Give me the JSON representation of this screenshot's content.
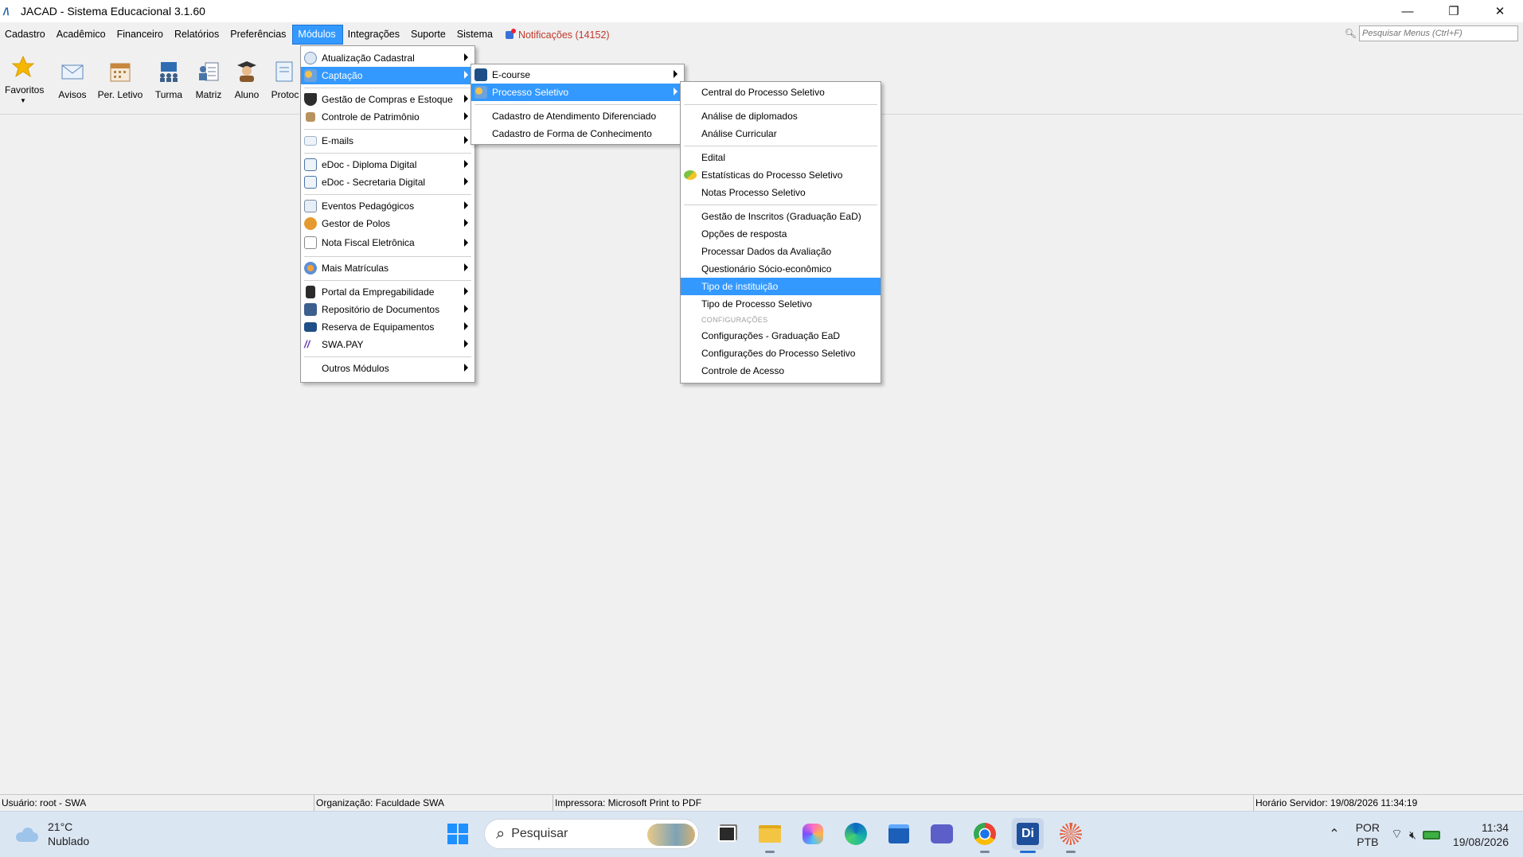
{
  "window": {
    "title": "JACAD - Sistema Educacional 3.1.60",
    "logo_text": "/\\",
    "controls": [
      "—",
      "❐",
      "✕"
    ]
  },
  "menubar": {
    "items": [
      "Cadastro",
      "Acadêmico",
      "Financeiro",
      "Relatórios",
      "Preferências",
      "Módulos",
      "Integrações",
      "Suporte",
      "Sistema"
    ],
    "notifications": "Notificações (14152)",
    "search_placeholder": "Pesquisar Menus (Ctrl+F)"
  },
  "toolbar": {
    "items": [
      "Favoritos",
      "Avisos",
      "Per. Letivo",
      "Turma",
      "Matriz",
      "Aluno",
      "Protoc"
    ]
  },
  "modulos_menu": {
    "items": [
      "Atualização Cadastral",
      "Captação",
      "Gestão de Compras e Estoque",
      "Controle de Patrimônio",
      "E-mails",
      "eDoc - Diploma Digital",
      "eDoc - Secretaria Digital",
      "Eventos Pedagógicos",
      "Gestor de Polos",
      "Nota Fiscal Eletrônica",
      "Mais Matrículas",
      "Portal da Empregabilidade",
      "Repositório de Documentos",
      "Reserva de Equipamentos",
      "SWA.PAY",
      "Outros Módulos"
    ]
  },
  "captacao_menu": {
    "items": [
      "E-course",
      "Processo Seletivo",
      "Cadastro de Atendimento Diferenciado",
      "Cadastro de Forma de Conhecimento"
    ]
  },
  "processo_menu": {
    "items": [
      "Central do Processo Seletivo",
      "Análise de diplomados",
      "Análise Curricular",
      "Edital",
      "Estatísticas do Processo Seletivo",
      "Notas Processo Seletivo",
      "Gestão de Inscritos (Graduação EaD)",
      "Opções de resposta",
      "Processar Dados da Avaliação",
      "Questionário Sócio-econômico",
      "Tipo de instituição",
      "Tipo de Processo Seletivo",
      "Configurações - Graduação EaD",
      "Configurações do Processo Seletivo",
      "Controle de Acesso"
    ],
    "section_header": "CONFIGURAÇÕES"
  },
  "statusbar": {
    "user": "Usuário: root - SWA",
    "org": "Organização: Faculdade SWA",
    "printer": "Impressora: Microsoft Print to PDF",
    "server_time": "Horário Servidor: 19/08/2026 11:34:19"
  },
  "taskbar": {
    "temperature": "21°C",
    "weather": "Nublado",
    "search_placeholder": "Pesquisar",
    "lang_1": "POR",
    "lang_2": "PTB",
    "time": "11:34",
    "date": "19/08/2026"
  },
  "colors": {
    "highlight": "#3399ff",
    "notification": "#c0392b",
    "taskbar": "#dbe6f3"
  }
}
